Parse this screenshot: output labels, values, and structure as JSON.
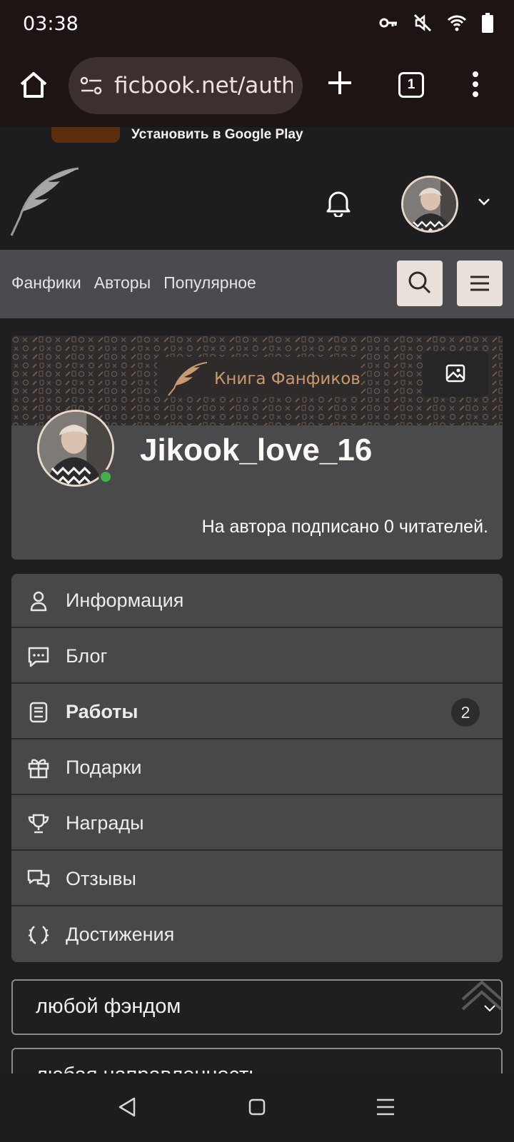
{
  "status_bar": {
    "time": "03:38",
    "icons": [
      "key-icon",
      "mute-icon",
      "wifi-icon",
      "battery-icon"
    ]
  },
  "browser": {
    "url": "ficbook.net/autho",
    "tab_count": "1",
    "icons": [
      "home-icon",
      "site-settings-icon",
      "plus-icon",
      "tabs-icon",
      "more-icon"
    ]
  },
  "install_banner": {
    "text": "Установить в Google Play"
  },
  "header": {
    "icons": [
      "feather-logo-icon",
      "bell-icon",
      "chevron-down-icon"
    ]
  },
  "nav": {
    "links": [
      "Фанфики",
      "Авторы",
      "Популярное"
    ],
    "icons": [
      "search-icon",
      "hamburger-icon"
    ]
  },
  "profile": {
    "cover_logo": "Книга Фанфиков",
    "username": "Jikook_love_16",
    "subscribers": "На автора подписано 0 читателей.",
    "online": true
  },
  "menu": {
    "items": [
      {
        "label": "Информация",
        "icon": "user-icon"
      },
      {
        "label": "Блог",
        "icon": "chat-icon"
      },
      {
        "label": "Работы",
        "icon": "book-icon",
        "badge": "2",
        "active": true
      },
      {
        "label": "Подарки",
        "icon": "gift-icon"
      },
      {
        "label": "Награды",
        "icon": "trophy-icon"
      },
      {
        "label": "Отзывы",
        "icon": "comments-icon"
      },
      {
        "label": "Достижения",
        "icon": "laurel-icon"
      }
    ]
  },
  "filters": {
    "fandom": "любой фэндом",
    "direction": "любая направленность"
  },
  "colors": {
    "accent": "#c89a6d",
    "online": "#46b14a",
    "background": "#1f1e21",
    "card": "#4a494c"
  }
}
